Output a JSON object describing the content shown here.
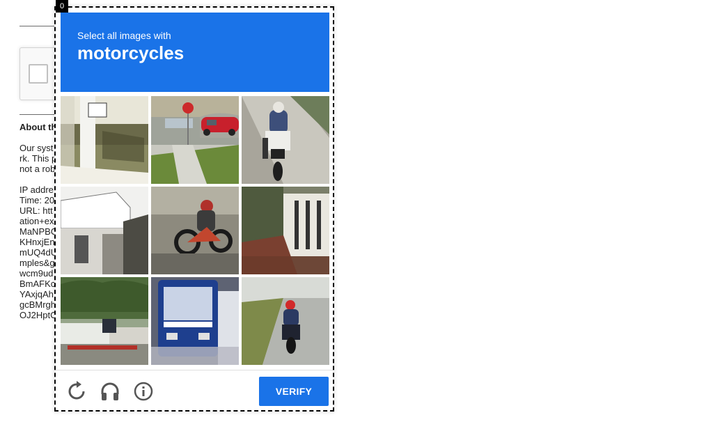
{
  "challenge": {
    "badge": "0",
    "instruction_prefix": "Select all images with",
    "target": "motorcycles",
    "verify_label": "VERIFY",
    "tiles": [
      {
        "id": "tile-1"
      },
      {
        "id": "tile-2"
      },
      {
        "id": "tile-3"
      },
      {
        "id": "tile-4"
      },
      {
        "id": "tile-5"
      },
      {
        "id": "tile-6"
      },
      {
        "id": "tile-7"
      },
      {
        "id": "tile-8"
      },
      {
        "id": "tile-9"
      }
    ],
    "controls": {
      "reload": "reload-icon",
      "audio": "headphones-icon",
      "info": "info-icon"
    },
    "colors": {
      "accent": "#1a73e8"
    }
  },
  "background": {
    "about_title": "About th",
    "lines": [
      "Our syst",
      "rk. This p",
      "not a rob",
      "",
      "IP addre",
      "Time: 20",
      "URL: htt",
      "ation+ex",
      "MaNPBC",
      "KHnxjEn",
      "mUQ4dU",
      "mples&g",
      "wcm9ud",
      "BmAFKc",
      "YAxjqAh",
      "gcBMrgh",
      "OJ2HptC"
    ]
  }
}
